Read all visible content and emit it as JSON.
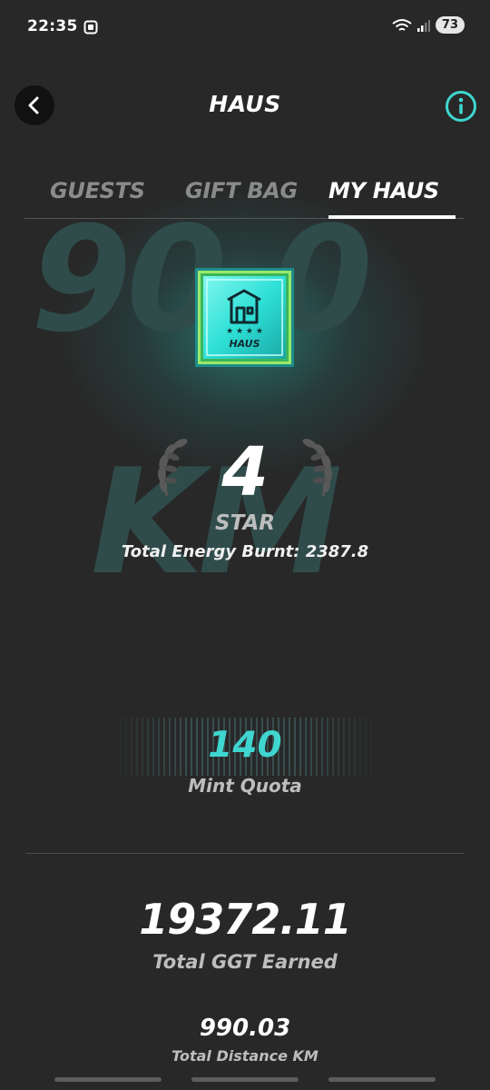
{
  "status_bar": {
    "time": "22:35",
    "battery": "73"
  },
  "header": {
    "title": "HAUS"
  },
  "tabs": [
    {
      "label": "GUESTS",
      "active": false
    },
    {
      "label": "GIFT BAG",
      "active": false
    },
    {
      "label": "MY HAUS",
      "active": true
    }
  ],
  "background": {
    "watermark_top": "90.0",
    "watermark_bottom": "KM"
  },
  "badge": {
    "label": "HAUS",
    "stars": 4
  },
  "haus": {
    "star_count": "4",
    "star_label": "STAR",
    "energy_text": "Total Energy Burnt: 2387.8"
  },
  "mint": {
    "value": "140",
    "label": "Mint Quota"
  },
  "totals": {
    "ggt_value": "19372.11",
    "ggt_label": "Total GGT Earned",
    "distance_value": "990.03",
    "distance_label": "Total Distance KM"
  },
  "colors": {
    "accent": "#3fd6d0",
    "background": "#282828",
    "watermark": "#2f4c4b"
  }
}
